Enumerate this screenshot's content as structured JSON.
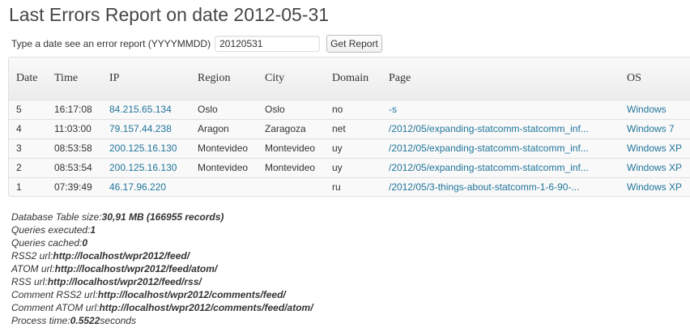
{
  "page": {
    "title": "Last Errors Report on date 2012-05-31"
  },
  "form": {
    "label": "Type a date see an error report (YYYYMMDD)",
    "date_value": "20120531",
    "button_label": "Get Report"
  },
  "table": {
    "headers": [
      "Date",
      "IP",
      "Region",
      "City",
      "Domain",
      "Page",
      "OS"
    ],
    "headers_full": {
      "date": "Date",
      "time": "Time",
      "ip": "IP",
      "region": "Region",
      "city": "City",
      "domain": "Domain",
      "page": "Page",
      "os": "OS"
    },
    "rows": [
      {
        "date": "5",
        "time": "16:17:08",
        "ip": "84.215.65.134",
        "region": "Oslo",
        "city": "Oslo",
        "domain": "no",
        "page": "-s",
        "os": "Windows"
      },
      {
        "date": "4",
        "time": "11:03:00",
        "ip": "79.157.44.238",
        "region": "Aragon",
        "city": "Zaragoza",
        "domain": "net",
        "page": "/2012/05/expanding-statcomm-statcomm_inf...",
        "os": "Windows 7"
      },
      {
        "date": "3",
        "time": "08:53:58",
        "ip": "200.125.16.130",
        "region": "Montevideo",
        "city": "Montevideo",
        "domain": "uy",
        "page": "/2012/05/expanding-statcomm-statcomm_inf...",
        "os": "Windows XP"
      },
      {
        "date": "2",
        "time": "08:53:54",
        "ip": "200.125.16.130",
        "region": "Montevideo",
        "city": "Montevideo",
        "domain": "uy",
        "page": "/2012/05/expanding-statcomm-statcomm_inf...",
        "os": "Windows XP"
      },
      {
        "date": "1",
        "time": "07:39:49",
        "ip": "46.17.96.220",
        "region": "",
        "city": "",
        "domain": "ru",
        "page": "/2012/05/3-things-about-statcomm-1-6-90-...",
        "os": "Windows XP"
      }
    ]
  },
  "stats": [
    {
      "label": "Database Table size:",
      "value": "30,91 MB (166955 records)",
      "suffix": ""
    },
    {
      "label": "Queries executed:",
      "value": "1",
      "suffix": ""
    },
    {
      "label": "Queries cached:",
      "value": "0",
      "suffix": ""
    },
    {
      "label": "RSS2 url:",
      "value": "http://localhost/wpr2012/feed/",
      "suffix": ""
    },
    {
      "label": "ATOM url:",
      "value": "http://localhost/wpr2012/feed/atom/",
      "suffix": ""
    },
    {
      "label": "RSS url:",
      "value": "http://localhost/wpr2012/feed/rss/",
      "suffix": ""
    },
    {
      "label": "Comment RSS2 url:",
      "value": "http://localhost/wpr2012/comments/feed/",
      "suffix": ""
    },
    {
      "label": "Comment ATOM url:",
      "value": "http://localhost/wpr2012/comments/feed/atom/",
      "suffix": ""
    },
    {
      "label": "Process time:",
      "value": "0.5522",
      "suffix": "seconds"
    }
  ],
  "colors": {
    "link": "#21759b",
    "title": "#464646"
  }
}
